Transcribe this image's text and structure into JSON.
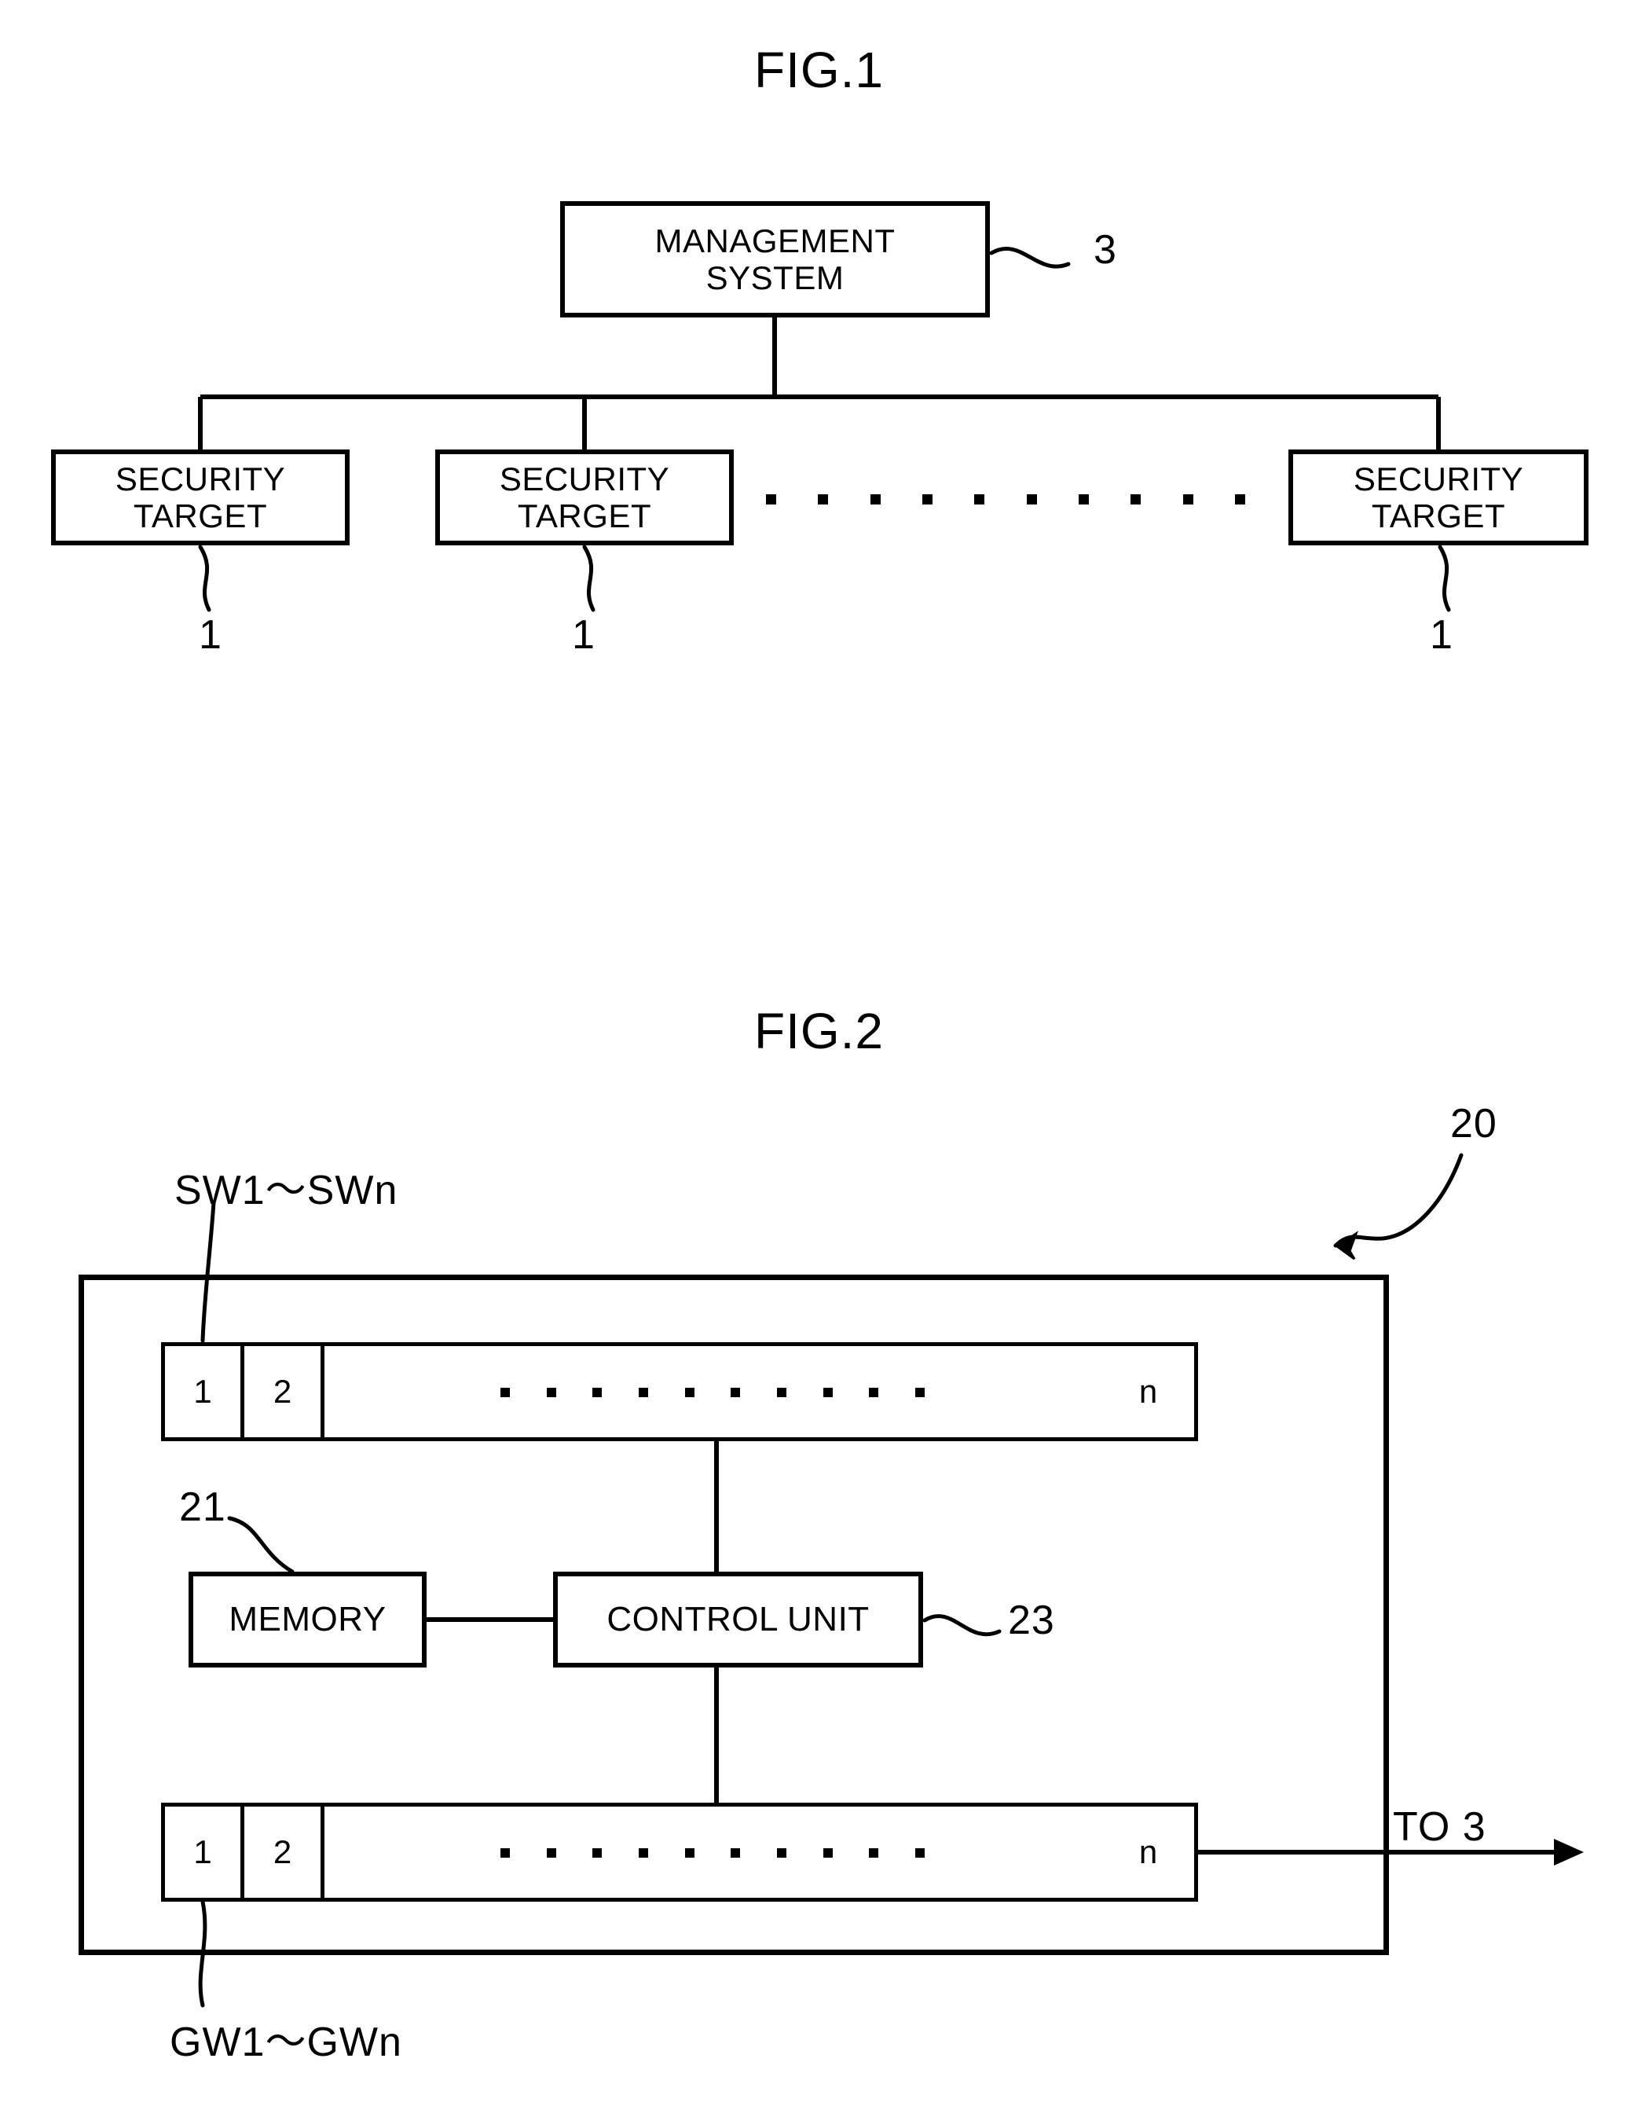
{
  "figures": [
    {
      "id": "fig1",
      "title": "FIG.1",
      "nodes": {
        "management_system": {
          "line1": "MANAGEMENT",
          "line2": "SYSTEM",
          "ref": "3"
        },
        "security_target_1": {
          "line1": "SECURITY",
          "line2": "TARGET",
          "ref": "1"
        },
        "security_target_2": {
          "line1": "SECURITY",
          "line2": "TARGET",
          "ref": "1"
        },
        "security_target_n": {
          "line1": "SECURITY",
          "line2": "TARGET",
          "ref": "1"
        }
      },
      "ellipsis_dot_count": 10
    },
    {
      "id": "fig2",
      "title": "FIG.2",
      "device_ref": "20",
      "top_bus_label": "SW1～SWn",
      "bottom_bus_label": "GW1～GWn",
      "output_label": "TO 3",
      "top_row_cells": [
        "1",
        "2",
        "n"
      ],
      "bottom_row_cells": [
        "1",
        "2",
        "n"
      ],
      "top_row_dot_count": 10,
      "bottom_row_dot_count": 10,
      "memory": {
        "label": "MEMORY",
        "ref": "21"
      },
      "control_unit": {
        "label": "CONTROL UNIT",
        "ref": "23"
      }
    }
  ],
  "style": {
    "ink": "#000000",
    "paper": "#ffffff"
  }
}
